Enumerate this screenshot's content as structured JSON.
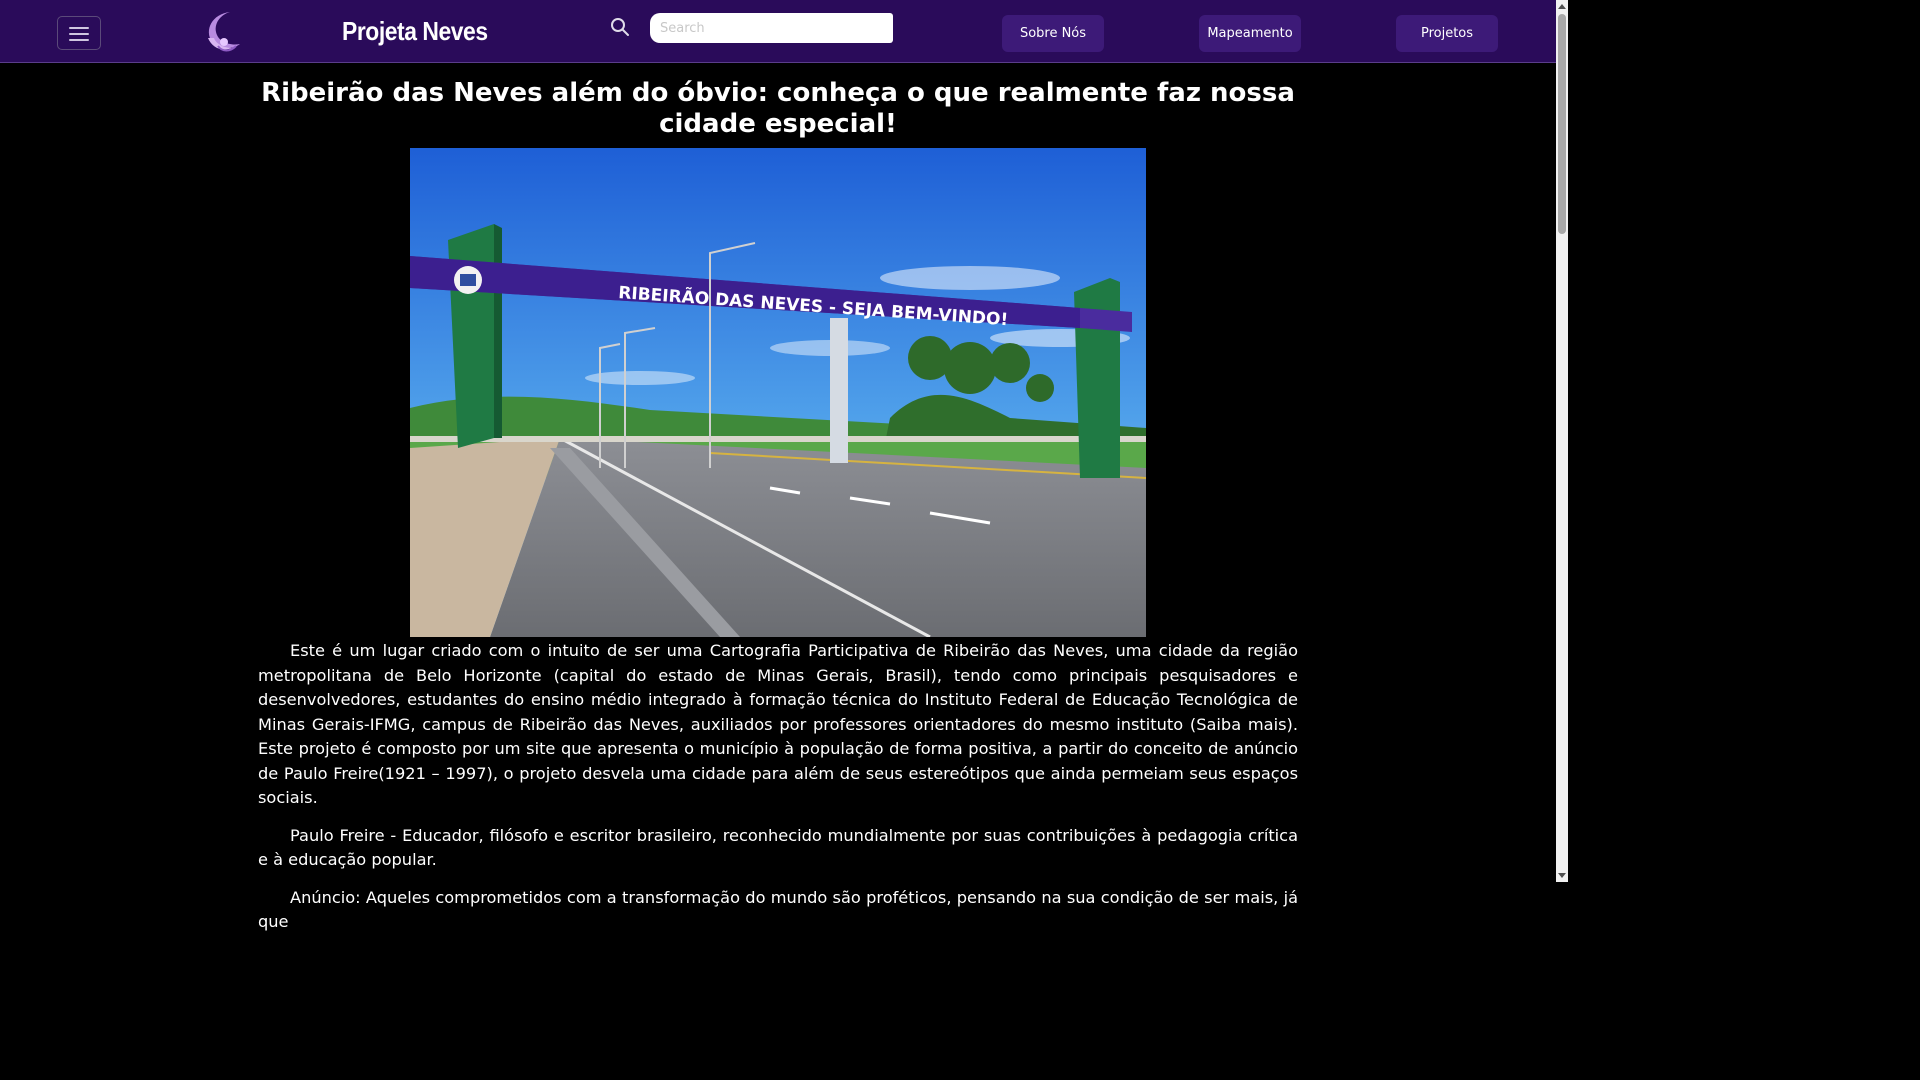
{
  "header": {
    "brand": "Projeta Neves",
    "search_placeholder": "Search",
    "nav": {
      "sobre": "Sobre Nós",
      "mapeamento": "Mapeamento",
      "projetos": "Projetos"
    }
  },
  "icons": {
    "menu": "hamburger-icon",
    "logo": "moon-hands-logo",
    "search": "search-icon"
  },
  "colors": {
    "navbar": "#2a0b5a",
    "nav_button": "#3d1a78",
    "background": "#000000",
    "text": "#ffffff"
  },
  "article": {
    "title": "Ribeirão das Neves além do óbvio: conheça o que realmente faz nossa cidade especial!",
    "image_sign": "RIBEIRÃO DAS NEVES - SEJA BEM-VINDO!",
    "paragraphs": [
      "Este é um lugar criado com o intuito de ser uma Cartografia Participativa de Ribeirão das Neves, uma cidade da região metropolitana de Belo Horizonte (capital do estado de Minas Gerais, Brasil), tendo como principais pesquisadores e desenvolvedores, estudantes do ensino médio integrado à formação técnica do Instituto Federal de Educação Tecnológica de Minas Gerais-IFMG, campus de Ribeirão das Neves, auxiliados por professores orientadores do mesmo instituto (Saiba mais). Este projeto é composto por um site que apresenta o município à população de forma positiva, a partir do conceito de anúncio de Paulo Freire(1921 – 1997), o projeto desvela uma cidade para além de seus estereótipos que ainda permeiam seus espaços sociais.",
      "Paulo Freire - Educador, filósofo e escritor brasileiro, reconhecido mundialmente por suas contribuições à pedagogia crítica e à educação popular.",
      "Anúncio: Aqueles comprometidos com a transformação do mundo são proféticos, pensando na sua condição de ser mais, já que"
    ]
  }
}
